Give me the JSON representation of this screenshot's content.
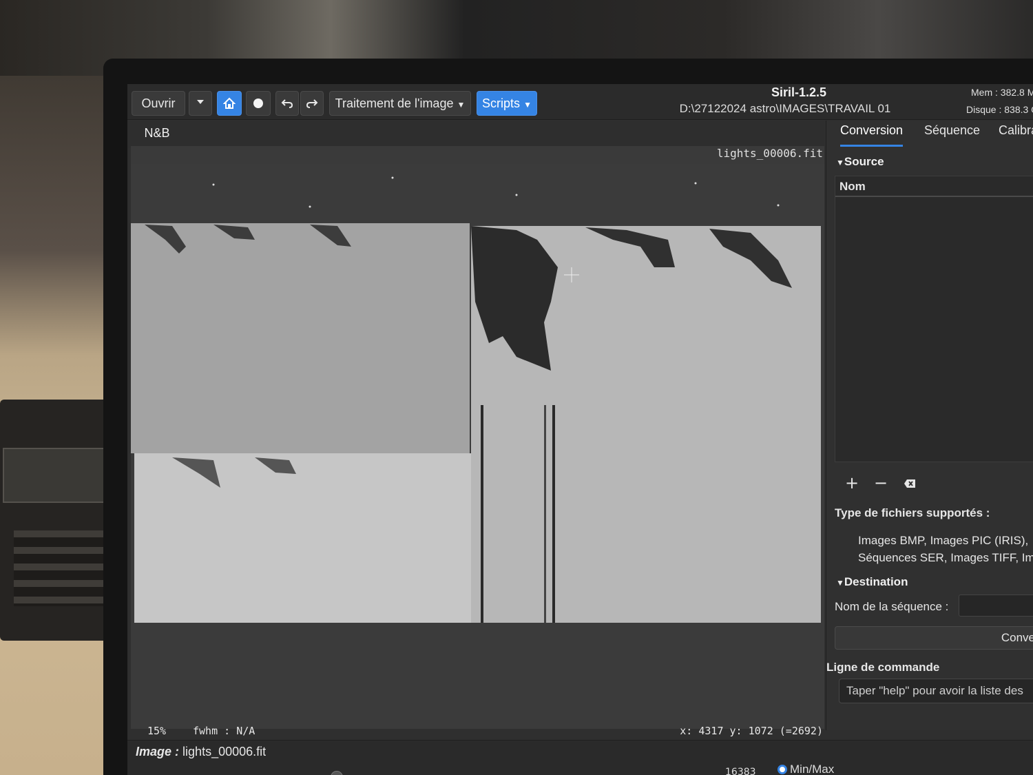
{
  "app": {
    "title": "Siril-1.2.5",
    "path": "D:\\27122024 astro\\IMAGES\\TRAVAIL 01",
    "mem": "Mem : 382.8 M",
    "disk": "Disque : 838.3 G"
  },
  "toolbar": {
    "open_label": "Ouvrir",
    "processing_label": "Traitement de l'image",
    "scripts_label": "Scripts"
  },
  "image_tabs": {
    "active": "N&B"
  },
  "viewer": {
    "filename": "lights_00006.fit",
    "zoom": "15%",
    "fwhm": "fwhm : N/A",
    "coords": "x: 4317 y: 1072 (=2692)"
  },
  "bottom": {
    "image_prefix": "Image :",
    "image_name": "lights_00006.fit",
    "pixel_value": "16383",
    "scale_mode": "Min/Max"
  },
  "right_panel": {
    "tabs": [
      "Conversion",
      "Séquence",
      "Calibra"
    ],
    "source_title": "Source",
    "list_header": "Nom",
    "types_label": "Type de fichiers supportés :",
    "types_line1": "Images BMP, Images PIC (IRIS),",
    "types_line2": "Séquences SER, Images TIFF, Im",
    "destination_title": "Destination",
    "seq_name_label": "Nom de la séquence :",
    "convert_label": "Conve",
    "cmd_label": "Ligne de commande",
    "cmd_placeholder": "Taper \"help\" pour avoir la liste des"
  },
  "icons": [
    "dropdown-arrow-icon",
    "home-icon",
    "record-icon",
    "undo-icon",
    "redo-icon",
    "add-icon",
    "remove-icon",
    "clear-icon"
  ],
  "colors": {
    "accent": "#3584e4",
    "panel": "#2f2f2f",
    "canvas": "#3b3b3b"
  }
}
